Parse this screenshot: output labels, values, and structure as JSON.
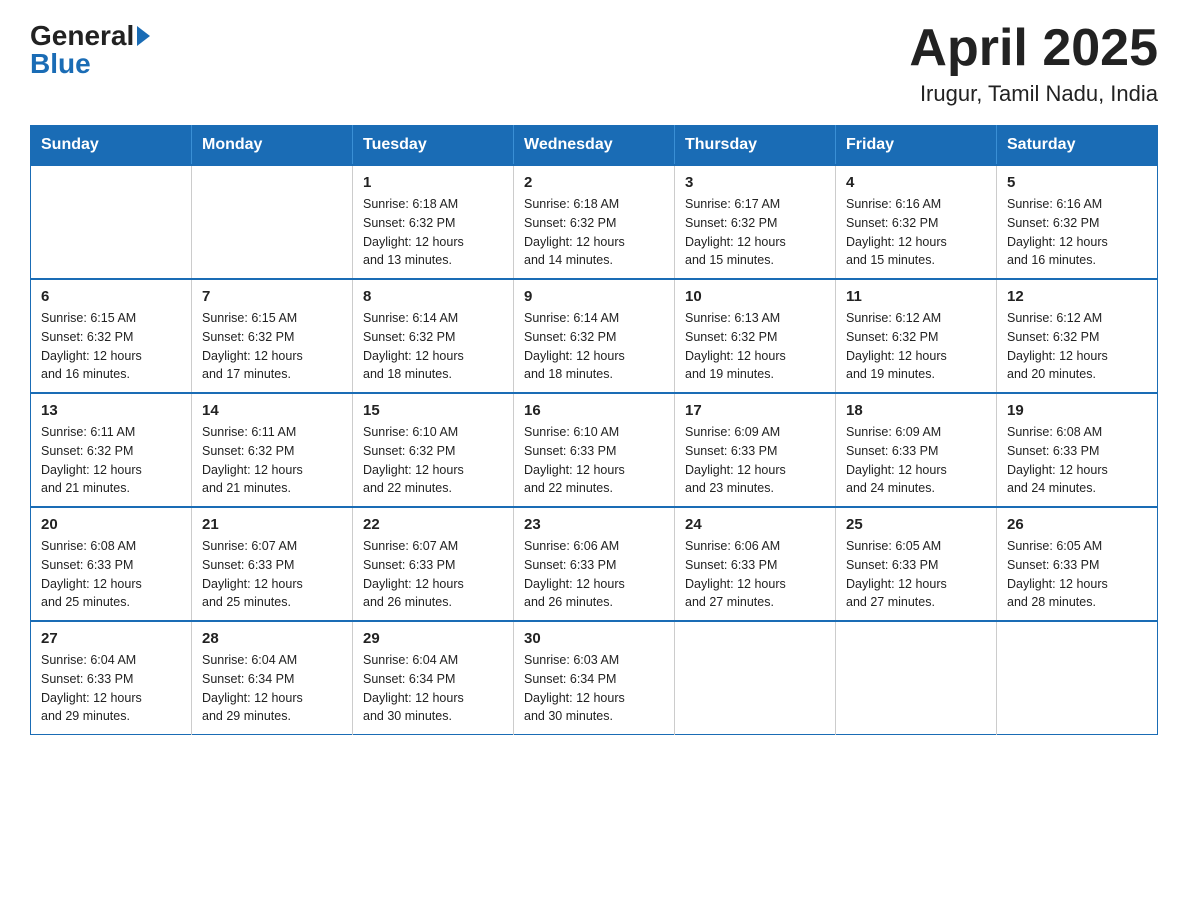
{
  "header": {
    "logo": {
      "general": "General",
      "blue": "Blue"
    },
    "title": "April 2025",
    "subtitle": "Irugur, Tamil Nadu, India"
  },
  "calendar": {
    "days_of_week": [
      "Sunday",
      "Monday",
      "Tuesday",
      "Wednesday",
      "Thursday",
      "Friday",
      "Saturday"
    ],
    "weeks": [
      [
        {
          "day": "",
          "info": ""
        },
        {
          "day": "",
          "info": ""
        },
        {
          "day": "1",
          "info": "Sunrise: 6:18 AM\nSunset: 6:32 PM\nDaylight: 12 hours\nand 13 minutes."
        },
        {
          "day": "2",
          "info": "Sunrise: 6:18 AM\nSunset: 6:32 PM\nDaylight: 12 hours\nand 14 minutes."
        },
        {
          "day": "3",
          "info": "Sunrise: 6:17 AM\nSunset: 6:32 PM\nDaylight: 12 hours\nand 15 minutes."
        },
        {
          "day": "4",
          "info": "Sunrise: 6:16 AM\nSunset: 6:32 PM\nDaylight: 12 hours\nand 15 minutes."
        },
        {
          "day": "5",
          "info": "Sunrise: 6:16 AM\nSunset: 6:32 PM\nDaylight: 12 hours\nand 16 minutes."
        }
      ],
      [
        {
          "day": "6",
          "info": "Sunrise: 6:15 AM\nSunset: 6:32 PM\nDaylight: 12 hours\nand 16 minutes."
        },
        {
          "day": "7",
          "info": "Sunrise: 6:15 AM\nSunset: 6:32 PM\nDaylight: 12 hours\nand 17 minutes."
        },
        {
          "day": "8",
          "info": "Sunrise: 6:14 AM\nSunset: 6:32 PM\nDaylight: 12 hours\nand 18 minutes."
        },
        {
          "day": "9",
          "info": "Sunrise: 6:14 AM\nSunset: 6:32 PM\nDaylight: 12 hours\nand 18 minutes."
        },
        {
          "day": "10",
          "info": "Sunrise: 6:13 AM\nSunset: 6:32 PM\nDaylight: 12 hours\nand 19 minutes."
        },
        {
          "day": "11",
          "info": "Sunrise: 6:12 AM\nSunset: 6:32 PM\nDaylight: 12 hours\nand 19 minutes."
        },
        {
          "day": "12",
          "info": "Sunrise: 6:12 AM\nSunset: 6:32 PM\nDaylight: 12 hours\nand 20 minutes."
        }
      ],
      [
        {
          "day": "13",
          "info": "Sunrise: 6:11 AM\nSunset: 6:32 PM\nDaylight: 12 hours\nand 21 minutes."
        },
        {
          "day": "14",
          "info": "Sunrise: 6:11 AM\nSunset: 6:32 PM\nDaylight: 12 hours\nand 21 minutes."
        },
        {
          "day": "15",
          "info": "Sunrise: 6:10 AM\nSunset: 6:32 PM\nDaylight: 12 hours\nand 22 minutes."
        },
        {
          "day": "16",
          "info": "Sunrise: 6:10 AM\nSunset: 6:33 PM\nDaylight: 12 hours\nand 22 minutes."
        },
        {
          "day": "17",
          "info": "Sunrise: 6:09 AM\nSunset: 6:33 PM\nDaylight: 12 hours\nand 23 minutes."
        },
        {
          "day": "18",
          "info": "Sunrise: 6:09 AM\nSunset: 6:33 PM\nDaylight: 12 hours\nand 24 minutes."
        },
        {
          "day": "19",
          "info": "Sunrise: 6:08 AM\nSunset: 6:33 PM\nDaylight: 12 hours\nand 24 minutes."
        }
      ],
      [
        {
          "day": "20",
          "info": "Sunrise: 6:08 AM\nSunset: 6:33 PM\nDaylight: 12 hours\nand 25 minutes."
        },
        {
          "day": "21",
          "info": "Sunrise: 6:07 AM\nSunset: 6:33 PM\nDaylight: 12 hours\nand 25 minutes."
        },
        {
          "day": "22",
          "info": "Sunrise: 6:07 AM\nSunset: 6:33 PM\nDaylight: 12 hours\nand 26 minutes."
        },
        {
          "day": "23",
          "info": "Sunrise: 6:06 AM\nSunset: 6:33 PM\nDaylight: 12 hours\nand 26 minutes."
        },
        {
          "day": "24",
          "info": "Sunrise: 6:06 AM\nSunset: 6:33 PM\nDaylight: 12 hours\nand 27 minutes."
        },
        {
          "day": "25",
          "info": "Sunrise: 6:05 AM\nSunset: 6:33 PM\nDaylight: 12 hours\nand 27 minutes."
        },
        {
          "day": "26",
          "info": "Sunrise: 6:05 AM\nSunset: 6:33 PM\nDaylight: 12 hours\nand 28 minutes."
        }
      ],
      [
        {
          "day": "27",
          "info": "Sunrise: 6:04 AM\nSunset: 6:33 PM\nDaylight: 12 hours\nand 29 minutes."
        },
        {
          "day": "28",
          "info": "Sunrise: 6:04 AM\nSunset: 6:34 PM\nDaylight: 12 hours\nand 29 minutes."
        },
        {
          "day": "29",
          "info": "Sunrise: 6:04 AM\nSunset: 6:34 PM\nDaylight: 12 hours\nand 30 minutes."
        },
        {
          "day": "30",
          "info": "Sunrise: 6:03 AM\nSunset: 6:34 PM\nDaylight: 12 hours\nand 30 minutes."
        },
        {
          "day": "",
          "info": ""
        },
        {
          "day": "",
          "info": ""
        },
        {
          "day": "",
          "info": ""
        }
      ]
    ]
  }
}
